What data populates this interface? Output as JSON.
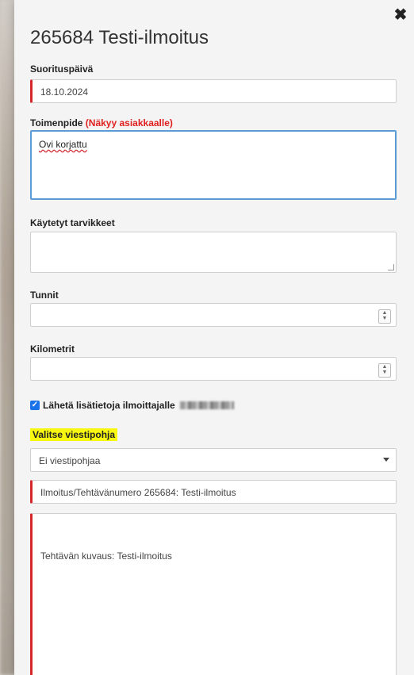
{
  "modal": {
    "title": "265684 Testi-ilmoitus",
    "close_label": "✖"
  },
  "form": {
    "date_label": "Suorituspäivä",
    "date_value": "18.10.2024",
    "action_label": "Toimenpide",
    "action_note": "(Näkyy asiakkaalle)",
    "action_value": "Ovi korjattu",
    "materials_label": "Käytetyt tarvikkeet",
    "materials_value": "",
    "hours_label": "Tunnit",
    "hours_value": "",
    "km_label": "Kilometrit",
    "km_value": "",
    "send_info_label": "Lähetä lisätietoja ilmoittajalle",
    "send_info_checked": true,
    "template_label": "Valitse viestipohja",
    "template_selected": "Ei viestipohjaa",
    "subject_value": "Ilmoitus/Tehtävänumero 265684: Testi-ilmoitus",
    "message_value": "Tehtävän kuvaus: Testi-ilmoitus"
  },
  "colors": {
    "required_marker": "#d4262b",
    "note_red": "#e0201e",
    "focus_blue": "#5b9bd5",
    "highlight_yellow": "#f7f711",
    "checkbox_blue": "#1a73e8"
  },
  "icons": {
    "close": "close-icon",
    "spinner": "spinner-arrows-icon",
    "dropdown": "chevron-down-icon",
    "resize": "resize-handle-icon",
    "checkbox": "checkmark-icon"
  }
}
